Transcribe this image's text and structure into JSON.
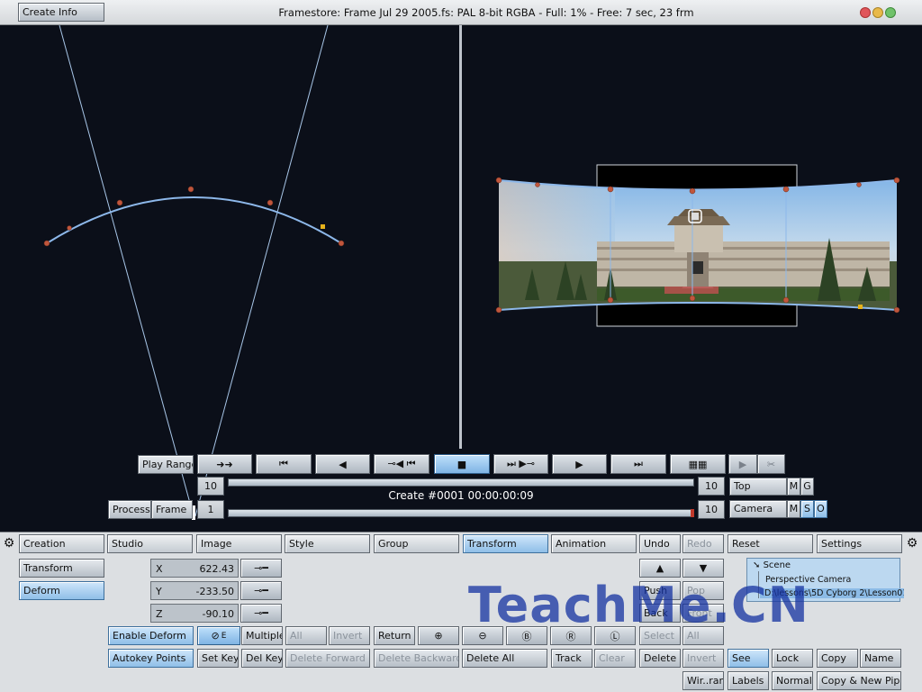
{
  "window": {
    "title": "Framestore: Frame   Jul 29 2005.fs: PAL 8-bit RGBA - Full: 1% - Free:   7 sec, 23 frm",
    "create_info_label": "Create Info",
    "traffic_colors": [
      "#e0555a",
      "#e8b94a",
      "#70c26a"
    ]
  },
  "viewport": {
    "background": "#0b0f19",
    "divider_color": "#bfc4cc",
    "spline_color": "#8db8ea",
    "control_point_color": "#c0563c"
  },
  "transport": {
    "play_range_label": "Play Range",
    "process_label": "Process",
    "frame_label": "Frame",
    "in_value": "10",
    "current_value": "1",
    "out_value": "10",
    "out2_value": "10",
    "status_text": "Create #0001   00:00:00:09",
    "buttons": [
      "arrows-icon",
      "rewind-to-start-icon",
      "step-back-icon",
      "back-key-icon",
      "prev-key-icon",
      "stop-icon",
      "next-key-icon",
      "forward-key-icon",
      "play-icon",
      "fast-forward-end-icon",
      "film-icon",
      "record-icon",
      "scissors-icon"
    ]
  },
  "views": {
    "top_view": {
      "label": "Top",
      "m": "M",
      "g": "G"
    },
    "camera_view": {
      "label": "Camera",
      "m": "M",
      "s": "S",
      "o": "O"
    }
  },
  "tabs": [
    {
      "label": "Creation",
      "selected": false
    },
    {
      "label": "Studio",
      "selected": false
    },
    {
      "label": "Image",
      "selected": false
    },
    {
      "label": "Style",
      "selected": false
    },
    {
      "label": "Group",
      "selected": false
    },
    {
      "label": "Transform",
      "selected": true
    },
    {
      "label": "Animation",
      "selected": false
    }
  ],
  "toolbar": {
    "undo": "Undo",
    "redo": "Redo",
    "reset": "Reset",
    "settings": "Settings"
  },
  "left_panel": {
    "transform": "Transform",
    "deform": "Deform",
    "enable_deform": "Enable Deform",
    "autokey_points": "Autokey Points"
  },
  "coords": {
    "x_label": "X",
    "x_value": "622.43",
    "y_label": "Y",
    "y_value": "-233.50",
    "z_label": "Z",
    "z_value": "-90.10"
  },
  "deform_row1": {
    "e_label": "E",
    "multiple": "Multiple",
    "all": "All",
    "invert": "Invert",
    "return": "Return",
    "b_label": "B",
    "r_label": "R",
    "l_label": "L"
  },
  "deform_row2": {
    "set_key": "Set Key",
    "del_key": "Del Key",
    "delete_forward": "Delete Forward",
    "delete_backward": "Delete Backward",
    "delete_all": "Delete All",
    "track": "Track",
    "clear": "Clear"
  },
  "right_controls": {
    "up_arrow": "▲",
    "down_arrow": "▼",
    "push": "Push",
    "pop": "Pop",
    "back": "Back",
    "front": "Front",
    "select": "Select",
    "select_all": "All",
    "delete": "Delete",
    "invert": "Invert"
  },
  "scene_tree": {
    "root": "Scene",
    "children": [
      "Perspective Camera",
      "D:\\lessons\\5D Cyborg 2\\Lesson01\\b.."
    ]
  },
  "bottom_right": {
    "see": "See",
    "lock": "Lock",
    "copy": "Copy",
    "name": "Name",
    "wireframe": "Wir..rame",
    "labels": "Labels",
    "normals": "Normals",
    "copy_new_pipe": "Copy & New Pipe"
  },
  "watermark": "TeachMe.CN"
}
